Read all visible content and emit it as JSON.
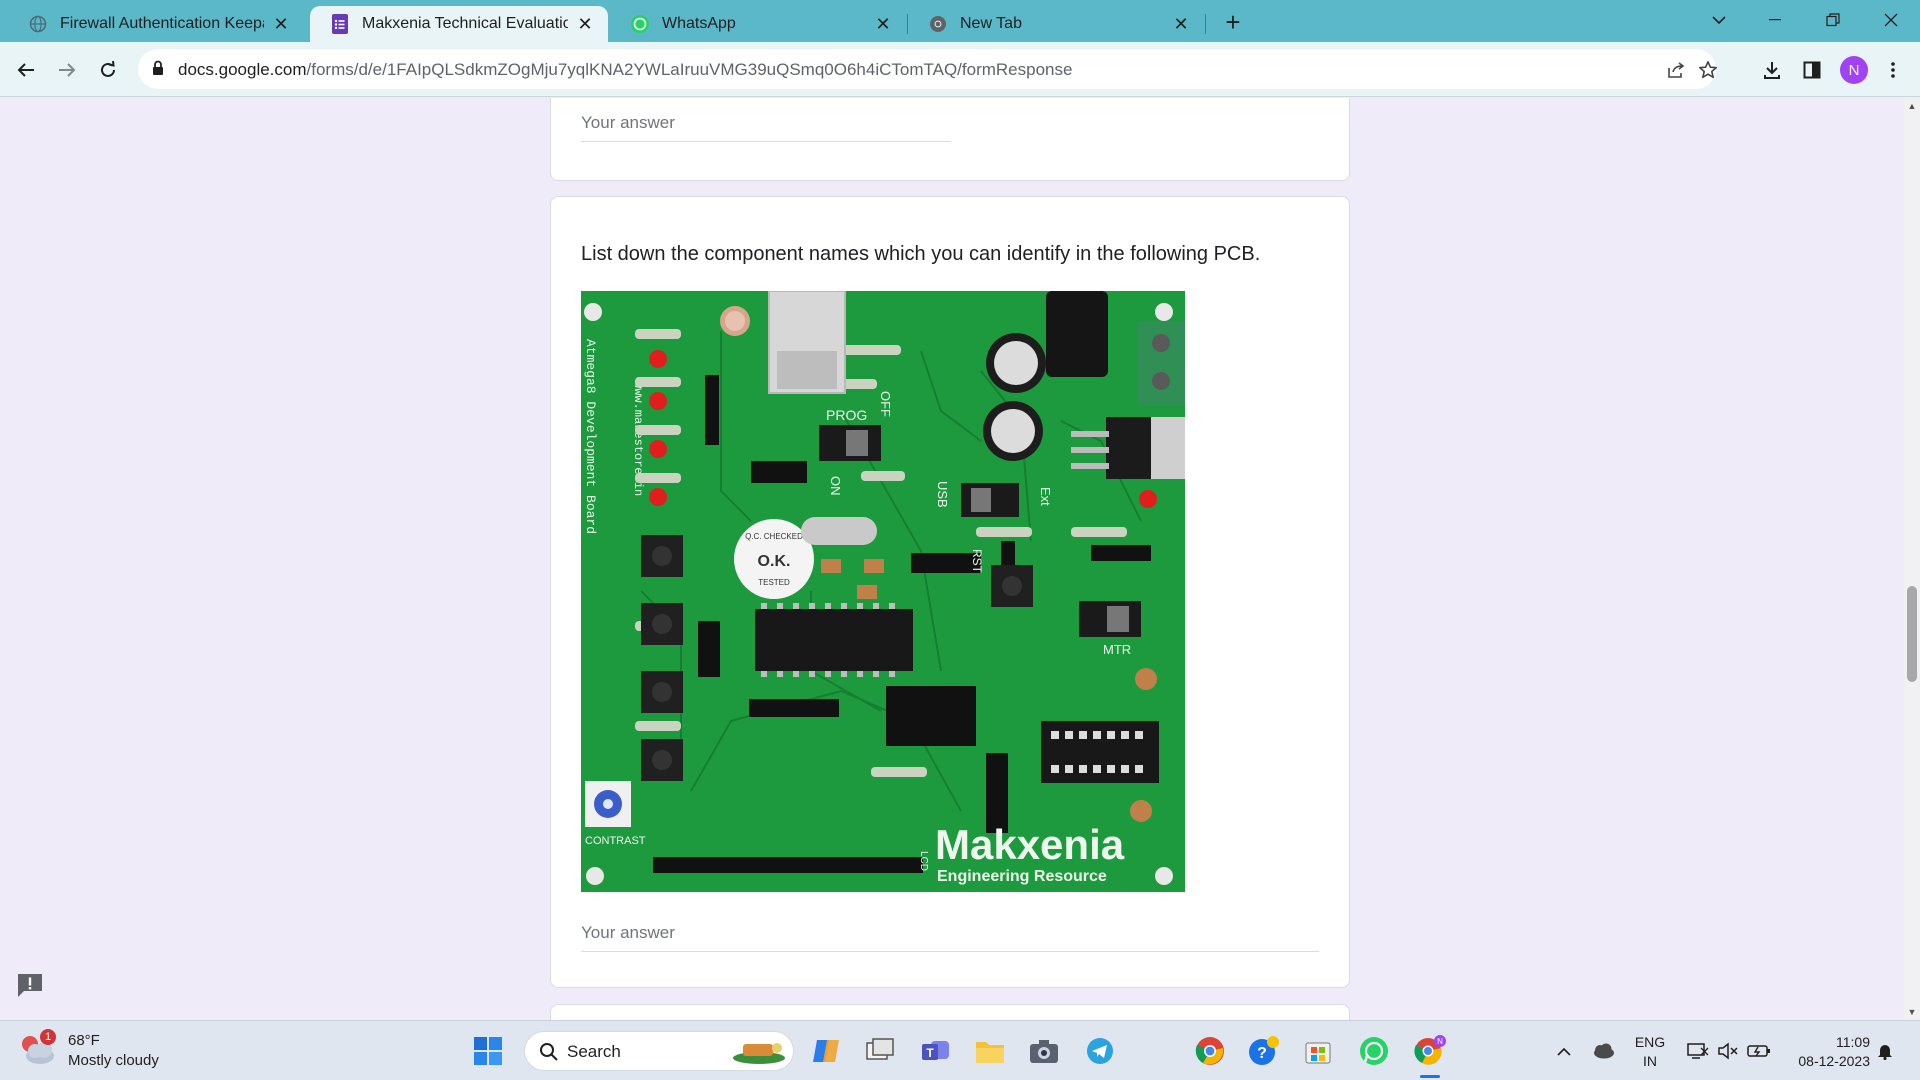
{
  "browser": {
    "tabs": [
      {
        "title": "Firewall Authentication Keepalive",
        "icon": "globe-icon"
      },
      {
        "title": "Makxenia Technical Evaluation Test",
        "icon": "google-forms-icon"
      },
      {
        "title": "WhatsApp",
        "icon": "whatsapp-icon"
      },
      {
        "title": "New Tab",
        "icon": "chrome-icon"
      }
    ],
    "url_host": "docs.google.com",
    "url_path": "/forms/d/e/1FAIpQLSdkmZOgMju7yqlKNA2YWLaIruuVMG39uQSmq0O6h4iCTomTAQ/formResponse",
    "profile_initial": "N"
  },
  "form": {
    "prev_answer_placeholder": "Your answer",
    "question_text": "List down the component names which you can identify in the following PCB.",
    "answer_placeholder": "Your answer",
    "pcb_labels": {
      "brand": "Makxenia",
      "brand_sub": "Engineering Resource",
      "side_text": "Atmega8 Development Board",
      "side_url": "www.makestore.in",
      "prog": "PROG",
      "off": "OFF",
      "on": "ON",
      "usb": "USB",
      "ext": "Ext",
      "mtr": "MTR",
      "contrast": "CONTRAST",
      "lcd": "LCD",
      "qc_top": "Q.C. CHECKED",
      "qc_mid": "O.K.",
      "qc_bot": "TESTED",
      "rst": "RST"
    }
  },
  "taskbar": {
    "weather_temp": "68°F",
    "weather_desc": "Mostly cloudy",
    "weather_badge": "1",
    "search_label": "Search",
    "lang_top": "ENG",
    "lang_bottom": "IN",
    "time": "11:09",
    "date": "08-12-2023"
  },
  "colors": {
    "tabstrip": "#5bb8c8",
    "toolbar": "#e8f4f6",
    "form_bg": "#f0ebf8",
    "pcb_green": "#1e9a3e",
    "avatar": "#a142f4"
  }
}
